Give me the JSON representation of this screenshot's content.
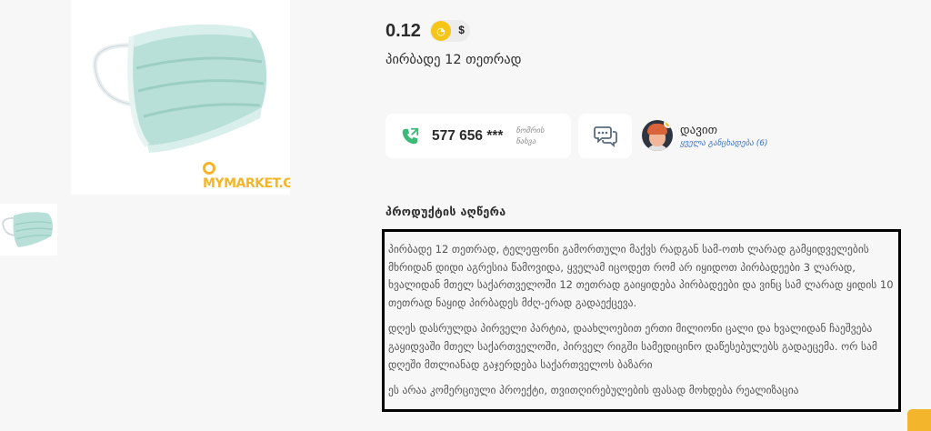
{
  "product": {
    "watermark": "MYMARKET.GE",
    "price": "0.12",
    "currency_alt": "$",
    "title": "პირბადე 12 თეთრად"
  },
  "contact": {
    "phone": "577 656 ***",
    "show_number": "ნომრის ნახვა"
  },
  "seller": {
    "name": "დავით",
    "all_listings": "ყველა განცხადება (6)"
  },
  "description": {
    "heading": "პროდუქტის აღწერა",
    "paragraphs": [
      "პირბადე 12 თეთრად, ტელეფონი გამორთული მაქვს რადგან სამ-ოთხ ლარად გამყიდველების მხრიდან დიდი აგრესია წამოვიდა, ყველამ იცოდეთ რომ არ იყიდოთ პირბადეები 3 ლარად, ხვალიდან მთელ საქართველოში 12 თეთრად გაიყიდება პირბადეები და ვინც სამ ლარად ყიდის 10 თეთრად ნაყიდ პირბადეს მძღ-ერად გადაექცევა.",
      "დღეს დასრულდა პირველი პარტია, დაახლოებით ერთი მილიონი ცალი და ხვალიდან ჩაეშვება გაყიდვაში მთელ საქართველოში, პირველ რიგში სამედიცინო დაწესებულებს გადაეცემა. ორ სამ დღეში მთლიანად გაჯერდება საქართველოს ბაზარი",
      "ეს არაა კომერციული პროექტი, თვითღირებულების ფასად მოხდება რეალიზაცია"
    ]
  },
  "colors": {
    "accent": "#f5c518",
    "phone_green": "#3cb878",
    "link_blue": "#3c74c7"
  },
  "icons": [
    "phone-icon",
    "chat-icon",
    "coin-icon"
  ]
}
